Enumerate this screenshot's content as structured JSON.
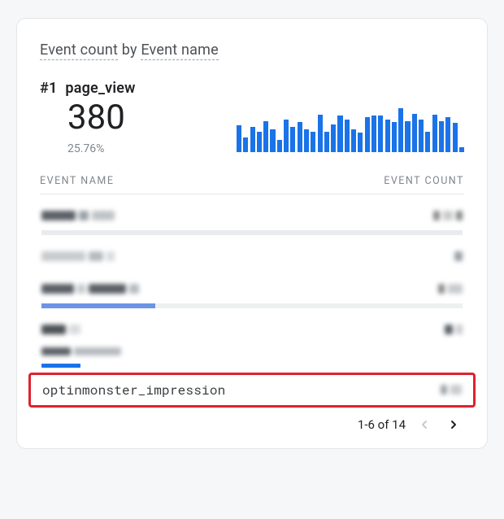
{
  "title_prefix": "Event count",
  "title_join": " by ",
  "title_dim": "Event name",
  "top_event": {
    "rank_label": "#1",
    "name": "page_view",
    "count": "380",
    "pct": "25.76%"
  },
  "table": {
    "col_event": "EVENT NAME",
    "col_count": "EVENT COUNT"
  },
  "rows": [
    {
      "name": "",
      "count": "",
      "bar_pct": 100,
      "redacted": true
    },
    {
      "name": "",
      "count": "",
      "bar_pct": 0,
      "redacted": true
    },
    {
      "name": "",
      "count": "",
      "bar_pct": 27,
      "redacted": true
    },
    {
      "name": "",
      "count": "",
      "bar_pct": 0,
      "redacted": true
    },
    {
      "name": "optinmonster_impression",
      "count": "",
      "bar_pct": 0,
      "highlight": true
    }
  ],
  "pager": {
    "label": "1-6 of 14",
    "prev_enabled": false,
    "next_enabled": true
  },
  "chart_data": {
    "type": "bar",
    "title": "page_view sparkline",
    "xlabel": "",
    "ylabel": "",
    "ylim": [
      0,
      100
    ],
    "categories": [
      "1",
      "2",
      "3",
      "4",
      "5",
      "6",
      "7",
      "8",
      "9",
      "10",
      "11",
      "12",
      "13",
      "14",
      "15",
      "16",
      "17",
      "18",
      "19",
      "20",
      "21",
      "22",
      "23",
      "24",
      "25",
      "26",
      "27",
      "28",
      "29",
      "30",
      "31",
      "32",
      "33",
      "34"
    ],
    "values": [
      52,
      28,
      48,
      40,
      60,
      44,
      24,
      62,
      48,
      58,
      44,
      40,
      72,
      40,
      54,
      70,
      62,
      44,
      38,
      68,
      70,
      70,
      62,
      58,
      84,
      60,
      74,
      62,
      40,
      72,
      60,
      68,
      56,
      10
    ]
  }
}
